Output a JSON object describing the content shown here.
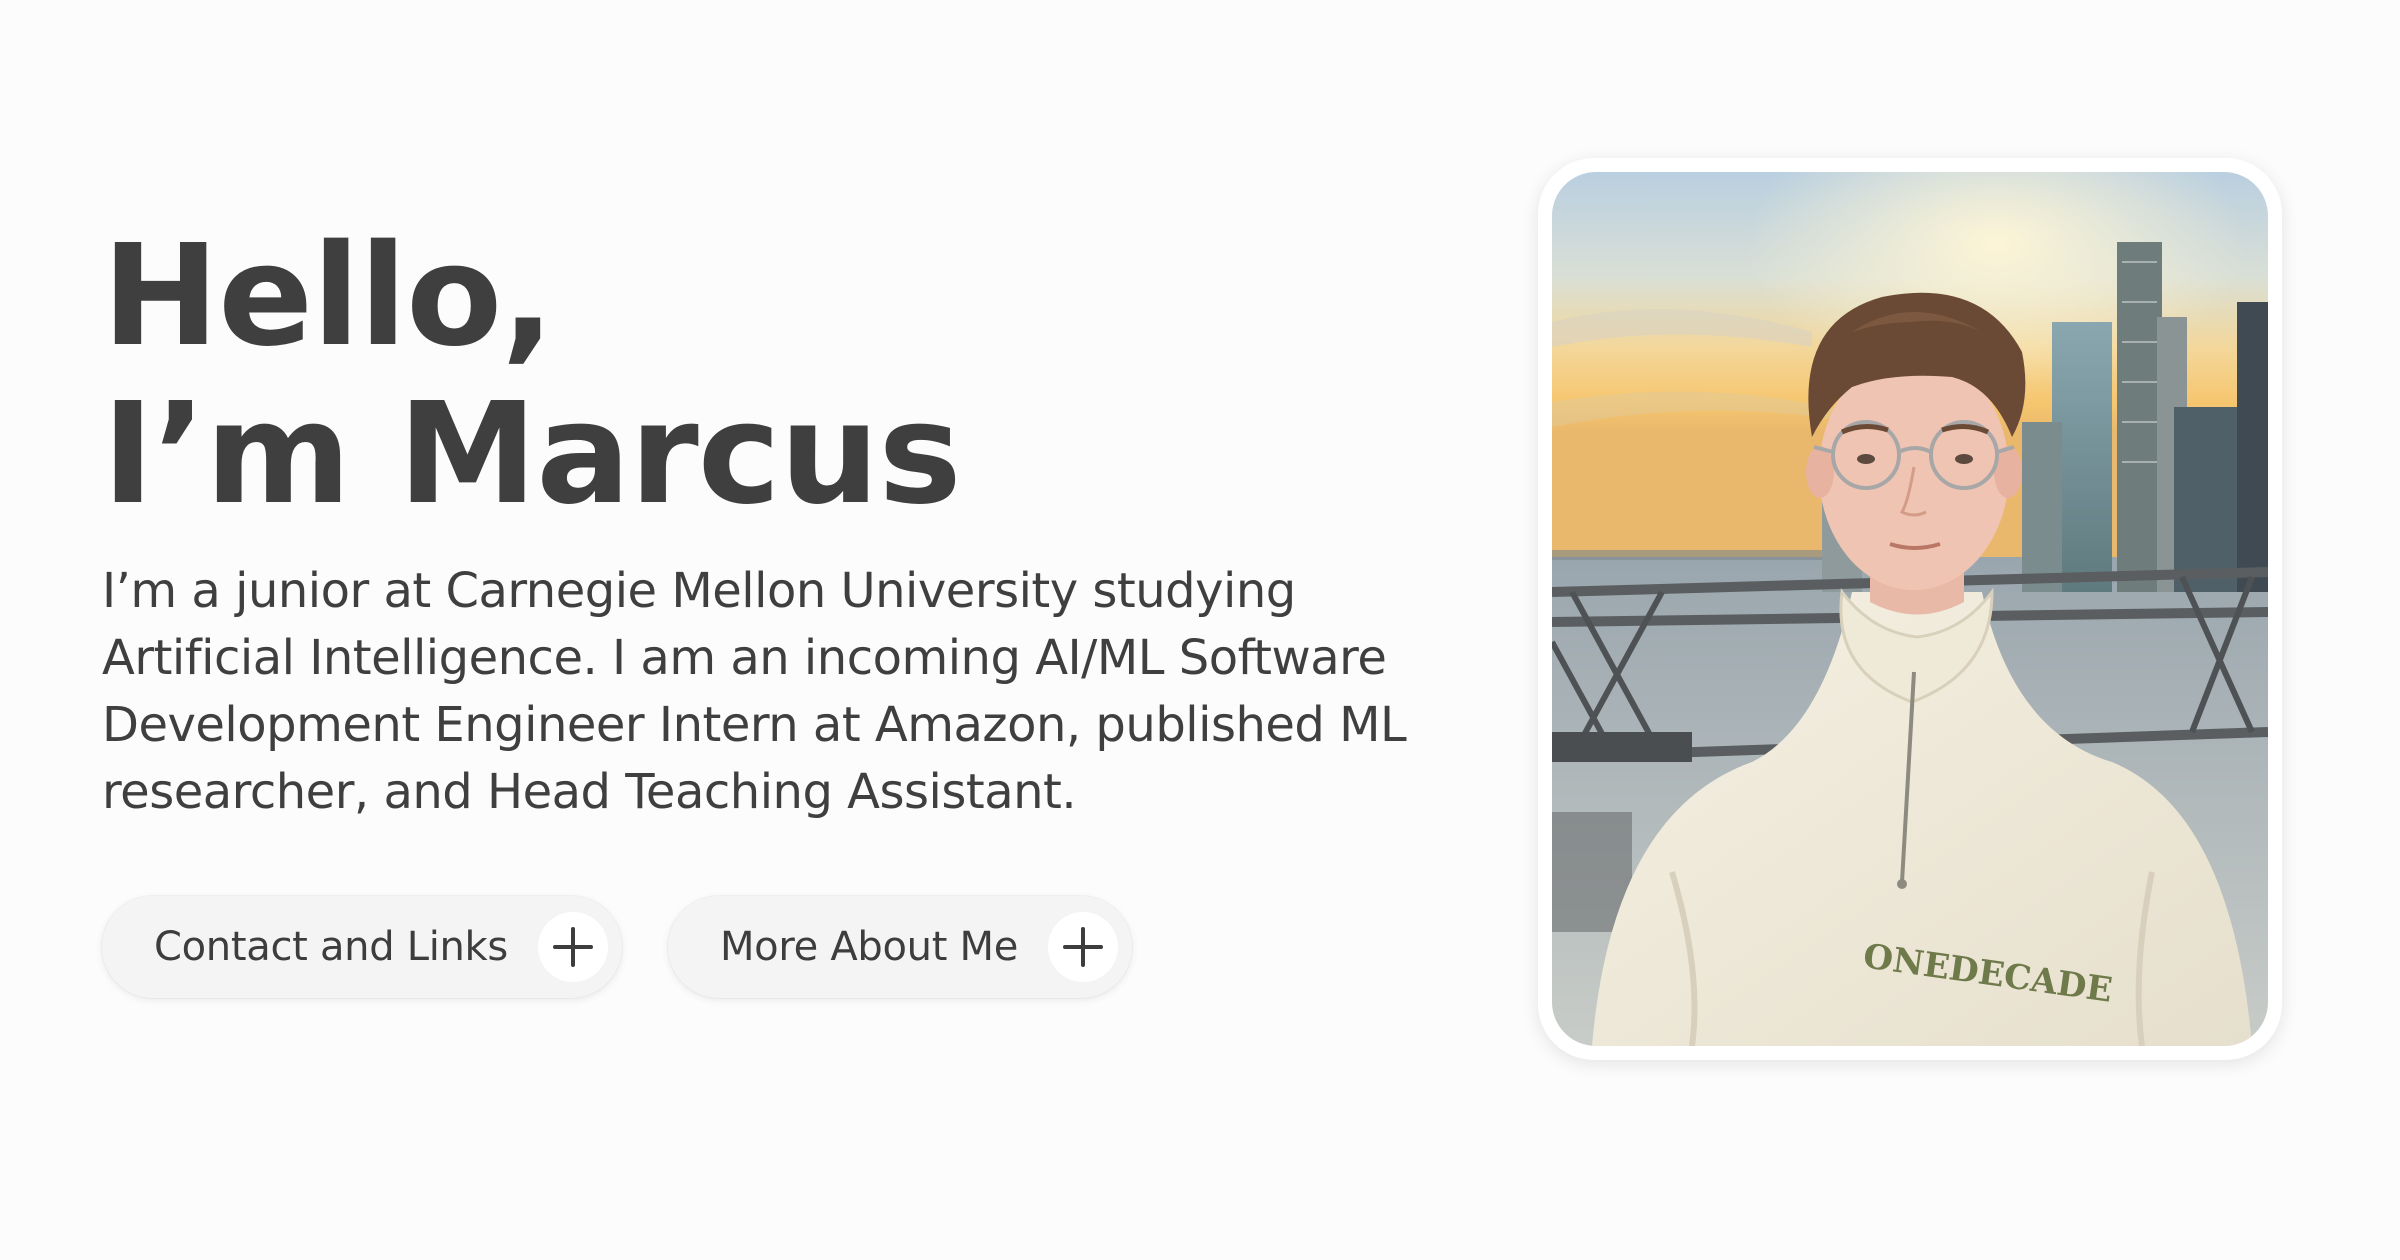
{
  "hero": {
    "headline_line1": "Hello,",
    "headline_line2": "I’m Marcus",
    "bio_lines": [
      "I’m a junior at Carnegie Mellon University studying",
      "Artificial Intelligence. I am an incoming AI/ML Software",
      "Development Engineer Intern at Amazon, published ML",
      "researcher, and Head Teaching Assistant."
    ]
  },
  "actions": {
    "contact_label": "Contact and Links",
    "more_label": "More About Me",
    "contact_icon": "plus-icon",
    "more_icon": "plus-icon"
  },
  "photo": {
    "subject": "portrait-photo",
    "sweatshirt_text": "ONE DECADE"
  },
  "colors": {
    "background": "#fcfcfc",
    "text": "#3f3f3f",
    "pill_bg": "#f4f4f4",
    "card_bg": "#ffffff"
  }
}
